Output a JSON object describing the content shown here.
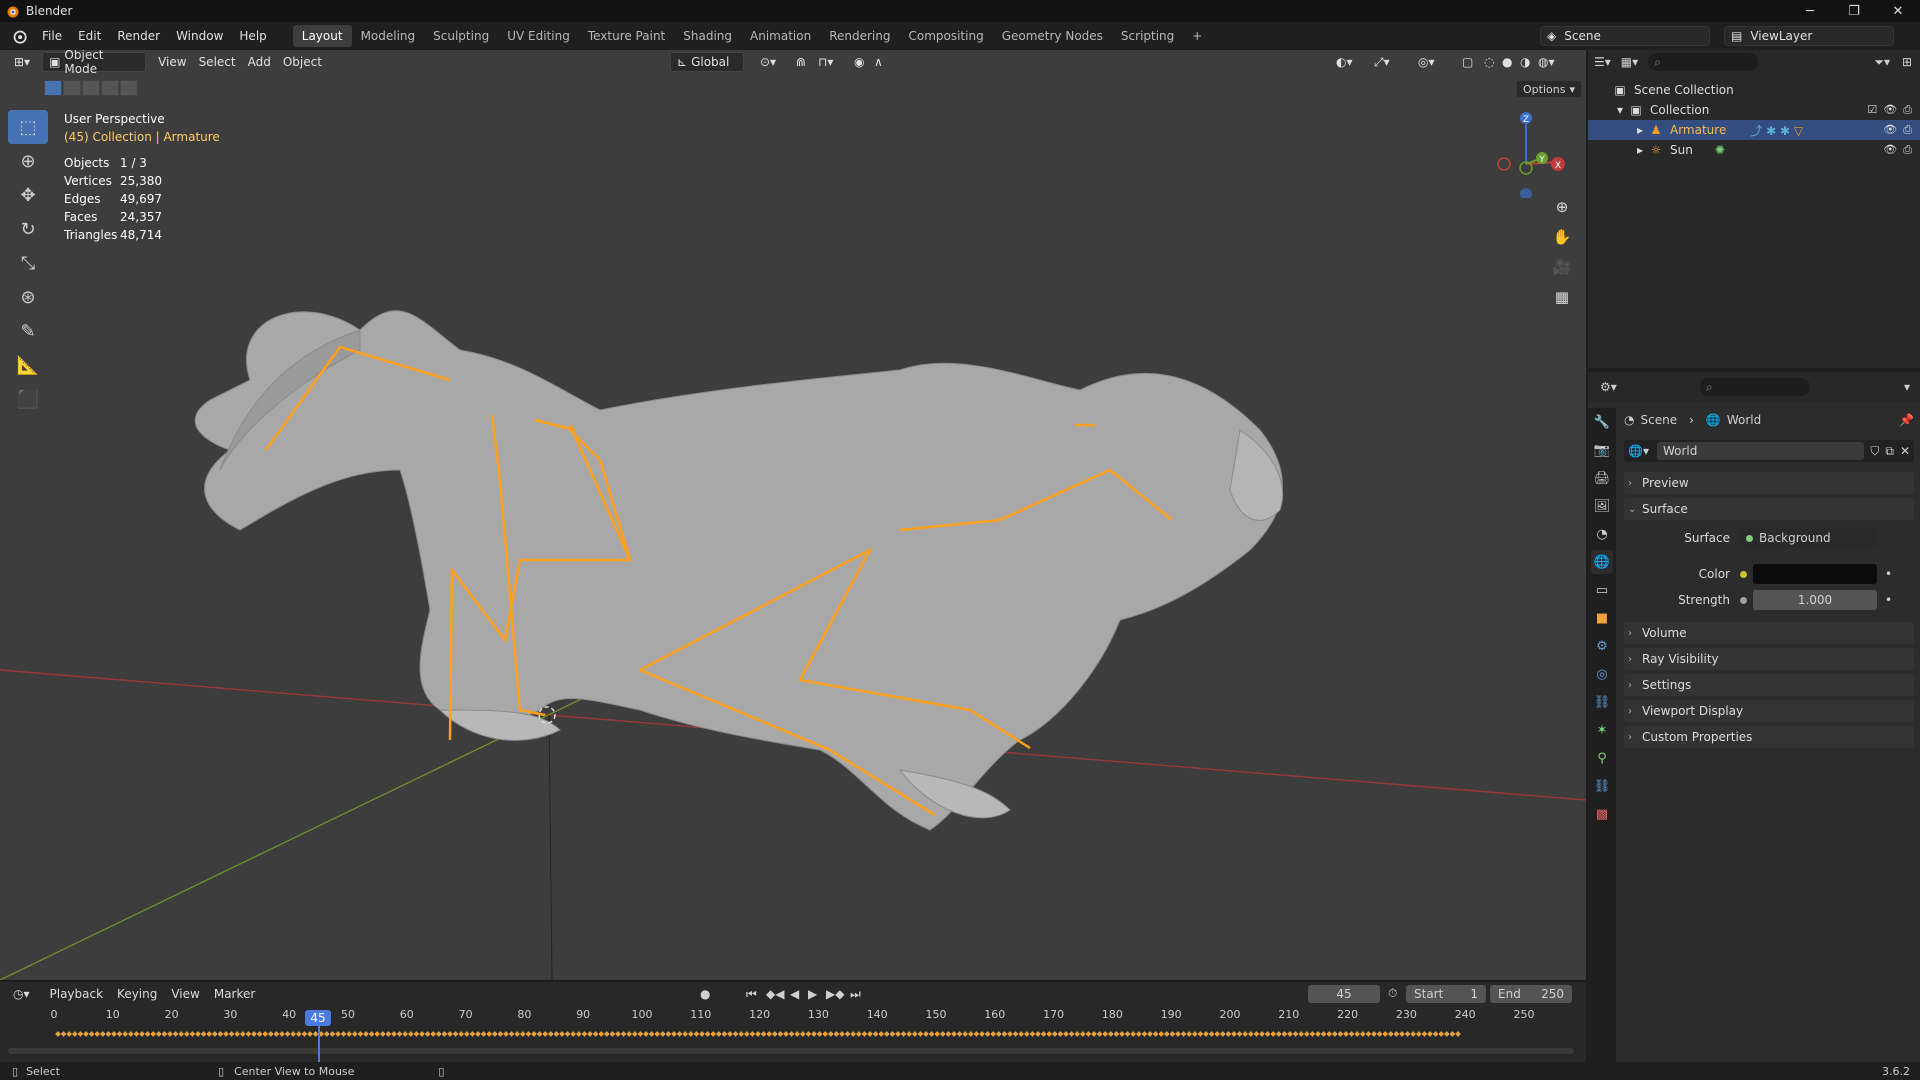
{
  "window": {
    "title": "Blender",
    "minimize": "─",
    "maximize": "❐",
    "close": "✕"
  },
  "menus": [
    "File",
    "Edit",
    "Render",
    "Window",
    "Help"
  ],
  "workspaces": [
    "Layout",
    "Modeling",
    "Sculpting",
    "UV Editing",
    "Texture Paint",
    "Shading",
    "Animation",
    "Rendering",
    "Compositing",
    "Geometry Nodes",
    "Scripting"
  ],
  "active_workspace": "Layout",
  "add_workspace": "+",
  "scene_name": "Scene",
  "view_layer": "ViewLayer",
  "viewport": {
    "mode": "Object Mode",
    "menus": [
      "View",
      "Select",
      "Add",
      "Object"
    ],
    "orientation": "Global",
    "options_label": "Options",
    "view_name": "User Perspective",
    "collection_info": "(45) Collection | Armature",
    "stats": [
      {
        "label": "Objects",
        "value": "1 / 3"
      },
      {
        "label": "Vertices",
        "value": "25,380"
      },
      {
        "label": "Edges",
        "value": "49,697"
      },
      {
        "label": "Faces",
        "value": "24,357"
      },
      {
        "label": "Triangles",
        "value": "48,714"
      }
    ],
    "gizmo_axes": {
      "x": "X",
      "y": "Y",
      "z": "Z"
    },
    "colors": {
      "background": "#3d3d3d",
      "bone": "#ff9f1c",
      "x_axis": "#b33c3c",
      "y_axis": "#6b8f2e"
    }
  },
  "outliner": {
    "rows": [
      {
        "label": "Scene Collection",
        "icon": "scene-collection-icon"
      },
      {
        "label": "Collection",
        "icon": "collection-icon"
      },
      {
        "label": "Armature",
        "icon": "armature-icon",
        "selected": true
      },
      {
        "label": "Sun",
        "icon": "sun-light-icon"
      }
    ]
  },
  "properties": {
    "breadcrumb": [
      "Scene",
      "World"
    ],
    "world_name": "World",
    "panels": {
      "preview": "Preview",
      "surface": "Surface",
      "volume": "Volume",
      "ray_visibility": "Ray Visibility",
      "settings": "Settings",
      "viewport_display": "Viewport Display",
      "custom_properties": "Custom Properties"
    },
    "surface_label": "Surface",
    "surface_value": "Background",
    "color_label": "Color",
    "strength_label": "Strength",
    "strength_value": "1.000"
  },
  "timeline": {
    "menus": [
      "Playback",
      "Keying",
      "View",
      "Marker"
    ],
    "current_frame": "45",
    "start_label": "Start",
    "start_value": "1",
    "end_label": "End",
    "end_value": "250",
    "ticks": [
      "0",
      "10",
      "20",
      "30",
      "40",
      "50",
      "60",
      "70",
      "80",
      "90",
      "100",
      "110",
      "120",
      "130",
      "140",
      "150",
      "160",
      "170",
      "180",
      "190",
      "200",
      "210",
      "220",
      "230",
      "240",
      "250"
    ]
  },
  "statusbar": {
    "left": "Select",
    "middle": "Center View to Mouse",
    "version": "3.6.2"
  }
}
